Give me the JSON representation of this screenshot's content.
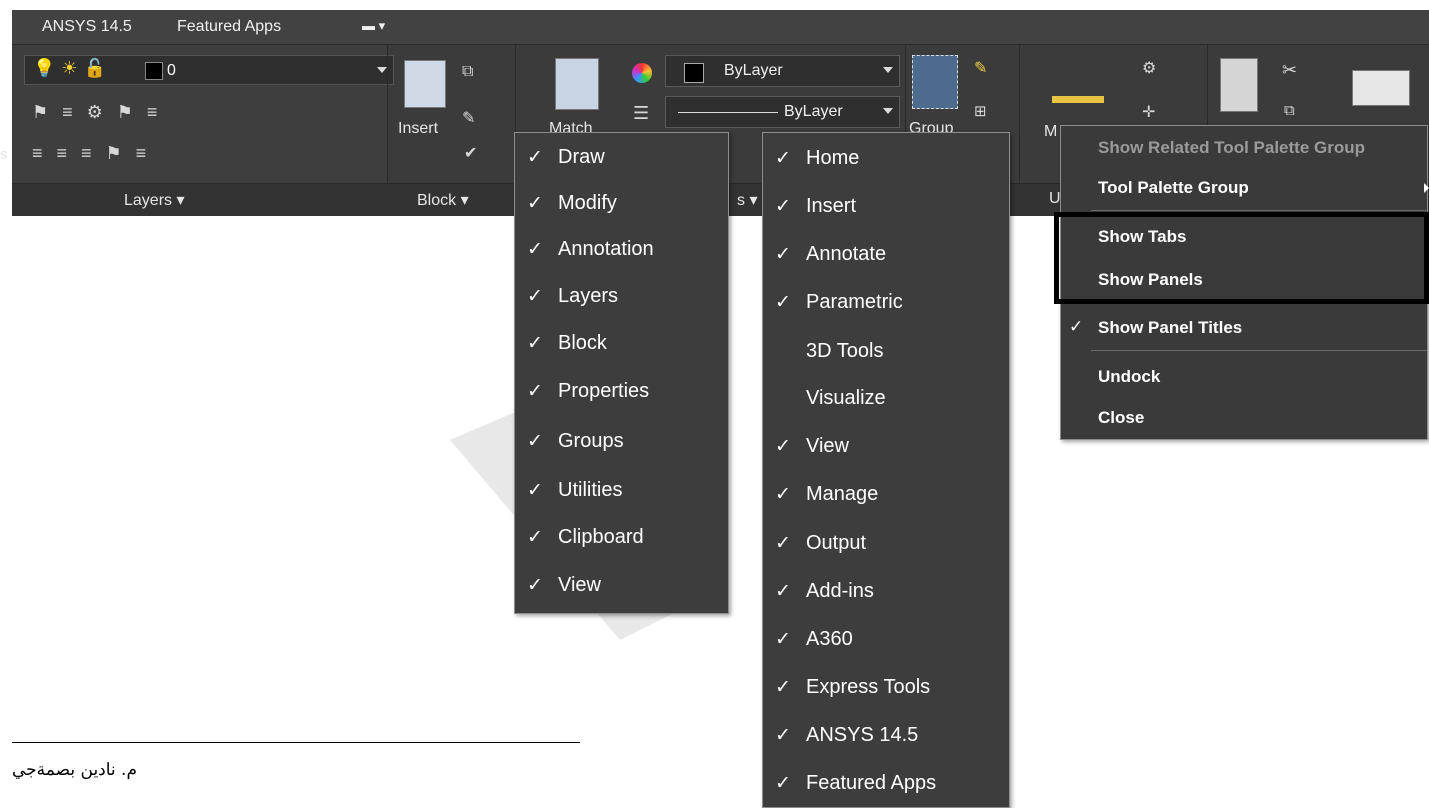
{
  "ribbon": {
    "tabs": [
      "ANSYS 14.5",
      "Featured Apps"
    ],
    "tab_control": "▬ ▾",
    "layer_combo_value": "0",
    "insert_label": "Insert",
    "match_label": "Match",
    "group_label": "Group",
    "measure_label": "M",
    "color_value": "ByLayer",
    "linetype_value": "ByLayer",
    "panel_titles": {
      "layers": "Layers ▾",
      "block": "Block ▾",
      "properties": "s ▾",
      "utilities": "U"
    },
    "left_fragment": "s"
  },
  "panels_menu": {
    "items": [
      {
        "label": "Draw",
        "checked": "✓"
      },
      {
        "label": "Modify",
        "checked": "✓"
      },
      {
        "label": "Annotation",
        "checked": "✓"
      },
      {
        "label": "Layers",
        "checked": "✓"
      },
      {
        "label": "Block",
        "checked": "✓"
      },
      {
        "label": "Properties",
        "checked": "✓"
      },
      {
        "label": "Groups",
        "checked": "✓"
      },
      {
        "label": "Utilities",
        "checked": "✓"
      },
      {
        "label": "Clipboard",
        "checked": "✓"
      },
      {
        "label": "View",
        "checked": "✓"
      }
    ]
  },
  "tabs_menu": {
    "items": [
      {
        "label": "Home",
        "checked": "✓"
      },
      {
        "label": "Insert",
        "checked": "✓"
      },
      {
        "label": "Annotate",
        "checked": "✓"
      },
      {
        "label": "Parametric",
        "checked": "✓"
      },
      {
        "label": "3D Tools",
        "checked": ""
      },
      {
        "label": "Visualize",
        "checked": ""
      },
      {
        "label": "View",
        "checked": "✓"
      },
      {
        "label": "Manage",
        "checked": "✓"
      },
      {
        "label": "Output",
        "checked": "✓"
      },
      {
        "label": "Add-ins",
        "checked": "✓"
      },
      {
        "label": "A360",
        "checked": "✓"
      },
      {
        "label": "Express Tools",
        "checked": "✓"
      },
      {
        "label": "ANSYS 14.5",
        "checked": "✓"
      },
      {
        "label": "Featured Apps",
        "checked": "✓"
      }
    ]
  },
  "context_menu": {
    "show_related": "Show Related Tool Palette Group",
    "tool_palette_group": "Tool Palette Group",
    "show_tabs": "Show Tabs",
    "show_panels": "Show Panels",
    "show_panel_titles": "Show Panel Titles",
    "show_panel_titles_check": "✓",
    "undock": "Undock",
    "close": "Close"
  },
  "footer": {
    "author": "م. نادين بصمةجي"
  },
  "colors": {
    "menu_bg": "#3d3d3d",
    "ribbon_bg": "#3b3b3b",
    "highlight": "#000000"
  }
}
